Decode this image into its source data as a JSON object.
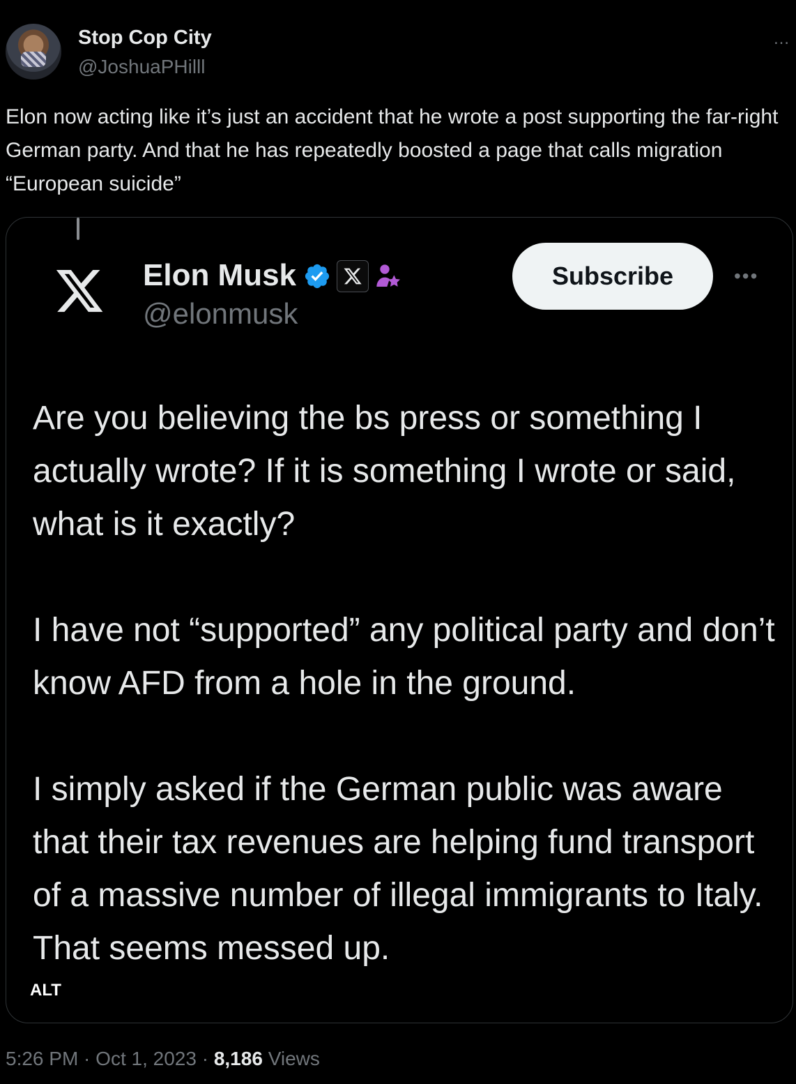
{
  "tweet": {
    "author_name": "Stop Cop City",
    "author_handle": "@JoshuaPHilll",
    "more_icon": "…",
    "text": "Elon now acting like it’s just an accident that he wrote a post supporting the far-right German party. And that he has repeatedly boosted a page that calls migration “European suicide”",
    "time": "5:26 PM",
    "date": "Oct 1, 2023",
    "separator": " · ",
    "views_count": "8,186",
    "views_label": "Views"
  },
  "quoted": {
    "name": "Elon Musk",
    "handle": "@elonmusk",
    "subscribe_label": "Subscribe",
    "more_icon": "•••",
    "paragraphs": [
      "Are you believing the bs press or something I actually wrote? If it is something I wrote or said, what is it exactly?",
      "I have not “supported” any political party and don’t know AFD from a hole in the ground.",
      "I simply asked if the German public was aware that their tax revenues are helping fund transport of a massive number of illegal immigrants to Italy. That seems messed up."
    ],
    "alt_label": "ALT"
  },
  "colors": {
    "background": "#000000",
    "text_primary": "#e7e9ea",
    "text_secondary": "#71767b",
    "verified_blue": "#1d9bf0",
    "affiliate_purple": "#b25ad6",
    "button_bg": "#eff3f4"
  },
  "icons": [
    "avatar",
    "more-icon",
    "x-logo-icon",
    "verified-badge-icon",
    "x-affiliate-badge-icon",
    "affiliate-person-star-icon"
  ]
}
